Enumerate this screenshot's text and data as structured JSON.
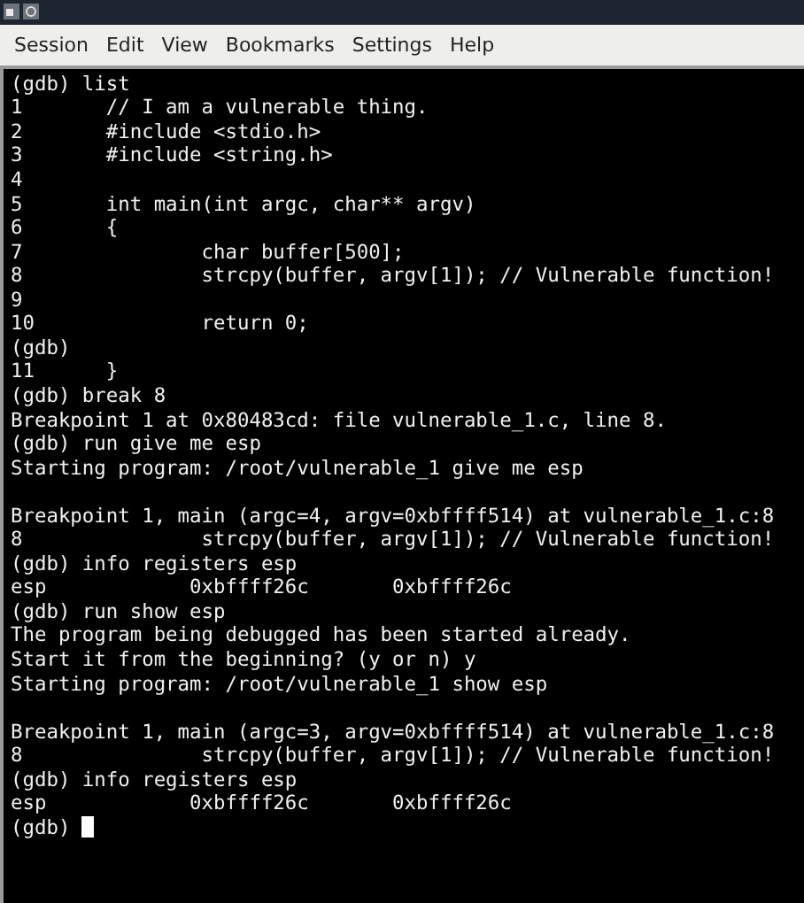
{
  "menu": [
    "Session",
    "Edit",
    "View",
    "Bookmarks",
    "Settings",
    "Help"
  ],
  "terminal": {
    "lines": [
      {
        "kind": "text",
        "text": "(gdb) list"
      },
      {
        "kind": "text",
        "text": "1       // I am a vulnerable thing."
      },
      {
        "kind": "text",
        "text": "2       #include <stdio.h>"
      },
      {
        "kind": "text",
        "text": "3       #include <string.h>"
      },
      {
        "kind": "text",
        "text": "4"
      },
      {
        "kind": "text",
        "text": "5       int main(int argc, char** argv)"
      },
      {
        "kind": "text",
        "text": "6       {"
      },
      {
        "kind": "text",
        "text": "7               char buffer[500];"
      },
      {
        "kind": "text",
        "text": "8               strcpy(buffer, argv[1]); // Vulnerable function!"
      },
      {
        "kind": "text",
        "text": "9"
      },
      {
        "kind": "text",
        "text": "10              return 0;"
      },
      {
        "kind": "text",
        "text": "(gdb)"
      },
      {
        "kind": "text",
        "text": "11      }"
      },
      {
        "kind": "text",
        "text": "(gdb) break 8"
      },
      {
        "kind": "text",
        "text": "Breakpoint 1 at 0x80483cd: file vulnerable_1.c, line 8."
      },
      {
        "kind": "text",
        "text": "(gdb) run give me esp"
      },
      {
        "kind": "text",
        "text": "Starting program: /root/vulnerable_1 give me esp"
      },
      {
        "kind": "blank"
      },
      {
        "kind": "text",
        "text": "Breakpoint 1, main (argc=4, argv=0xbffff514) at vulnerable_1.c:8"
      },
      {
        "kind": "text",
        "text": "8               strcpy(buffer, argv[1]); // Vulnerable function!"
      },
      {
        "kind": "text",
        "text": "(gdb) info registers esp"
      },
      {
        "kind": "text",
        "text": "esp            0xbffff26c       0xbffff26c"
      },
      {
        "kind": "text",
        "text": "(gdb) run show esp"
      },
      {
        "kind": "text",
        "text": "The program being debugged has been started already."
      },
      {
        "kind": "text",
        "text": "Start it from the beginning? (y or n) y"
      },
      {
        "kind": "text",
        "text": "Starting program: /root/vulnerable_1 show esp"
      },
      {
        "kind": "blank"
      },
      {
        "kind": "text",
        "text": "Breakpoint 1, main (argc=3, argv=0xbffff514) at vulnerable_1.c:8"
      },
      {
        "kind": "text",
        "text": "8               strcpy(buffer, argv[1]); // Vulnerable function!"
      },
      {
        "kind": "text",
        "text": "(gdb) info registers esp"
      },
      {
        "kind": "text",
        "text": "esp            0xbffff26c       0xbffff26c"
      }
    ],
    "prompt": "(gdb)",
    "cursor": true
  }
}
